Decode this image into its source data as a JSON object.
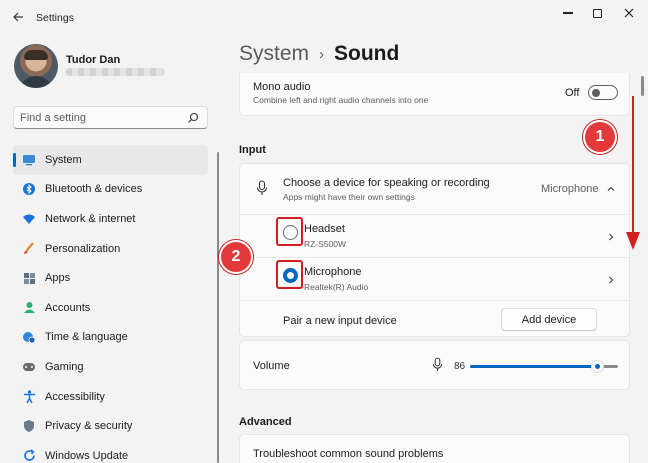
{
  "window": {
    "title": "Settings"
  },
  "user": {
    "name": "Tudor Dan"
  },
  "search": {
    "placeholder": "Find a setting"
  },
  "sidebar": {
    "items": [
      {
        "label": "System",
        "icon": "system-icon",
        "selected": true
      },
      {
        "label": "Bluetooth & devices",
        "icon": "bluetooth-icon"
      },
      {
        "label": "Network & internet",
        "icon": "wifi-icon"
      },
      {
        "label": "Personalization",
        "icon": "brush-icon"
      },
      {
        "label": "Apps",
        "icon": "apps-icon"
      },
      {
        "label": "Accounts",
        "icon": "person-icon"
      },
      {
        "label": "Time & language",
        "icon": "globe-clock-icon"
      },
      {
        "label": "Gaming",
        "icon": "gamepad-icon"
      },
      {
        "label": "Accessibility",
        "icon": "accessibility-icon"
      },
      {
        "label": "Privacy & security",
        "icon": "shield-icon"
      },
      {
        "label": "Windows Update",
        "icon": "update-icon"
      }
    ]
  },
  "header": {
    "parent": "System",
    "separator": "›",
    "current": "Sound"
  },
  "mono_audio": {
    "title": "Mono audio",
    "subtitle": "Combine left and right audio channels into one",
    "state_label": "Off",
    "checked": false
  },
  "input_section": {
    "label": "Input",
    "chooser": {
      "title": "Choose a device for speaking or recording",
      "subtitle": "Apps might have their own settings",
      "selected_value": "Microphone"
    },
    "devices": [
      {
        "name": "Headset",
        "detail": "RZ-S500W",
        "selected": false
      },
      {
        "name": "Microphone",
        "detail": "Realtek(R) Audio",
        "selected": true
      }
    ],
    "pair": {
      "label": "Pair a new input device",
      "button_label": "Add device"
    }
  },
  "volume": {
    "label": "Volume",
    "value": "86",
    "level": 0.86
  },
  "advanced": {
    "label": "Advanced",
    "troubleshoot_label": "Troubleshoot common sound problems"
  },
  "annotations": [
    {
      "number": "1"
    },
    {
      "number": "2"
    }
  ],
  "colors": {
    "accent": "#0067c0",
    "annotation_red": "#e23a3a",
    "background": "#f3f3f3",
    "card": "#fbfbfb"
  }
}
